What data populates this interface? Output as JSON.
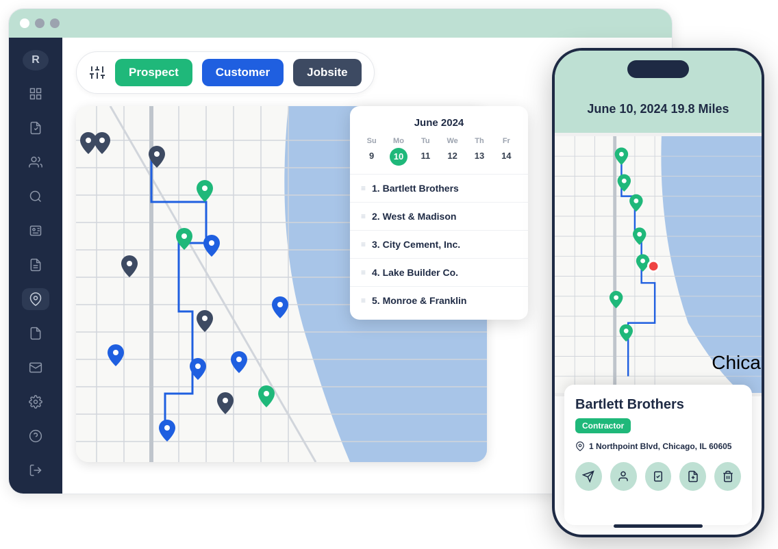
{
  "filters": {
    "prospect": "Prospect",
    "customer": "Customer",
    "jobsite": "Jobsite"
  },
  "calendar": {
    "title": "June 2024",
    "heads": [
      "Su",
      "Mo",
      "Tu",
      "We",
      "Th",
      "Fr"
    ],
    "days": [
      "9",
      "10",
      "11",
      "12",
      "13",
      "14"
    ],
    "selected_index": 1
  },
  "route": [
    "1. Bartlett Brothers",
    "2. West & Madison",
    "3. City Cement, Inc.",
    "4. Lake Builder Co.",
    "5. Monroe & Franklin"
  ],
  "mobile": {
    "header": "June 10, 2024 19.8 Miles",
    "city": "Chicago",
    "card": {
      "title": "Bartlett Brothers",
      "badge": "Contractor",
      "address": "1 Northpoint Blvd, Chicago, IL 60605"
    }
  },
  "colors": {
    "green": "#1fb87a",
    "blue": "#1f5fe0",
    "dark": "#3d4a62",
    "mint": "#bee0d3",
    "navy": "#1e2a44"
  }
}
